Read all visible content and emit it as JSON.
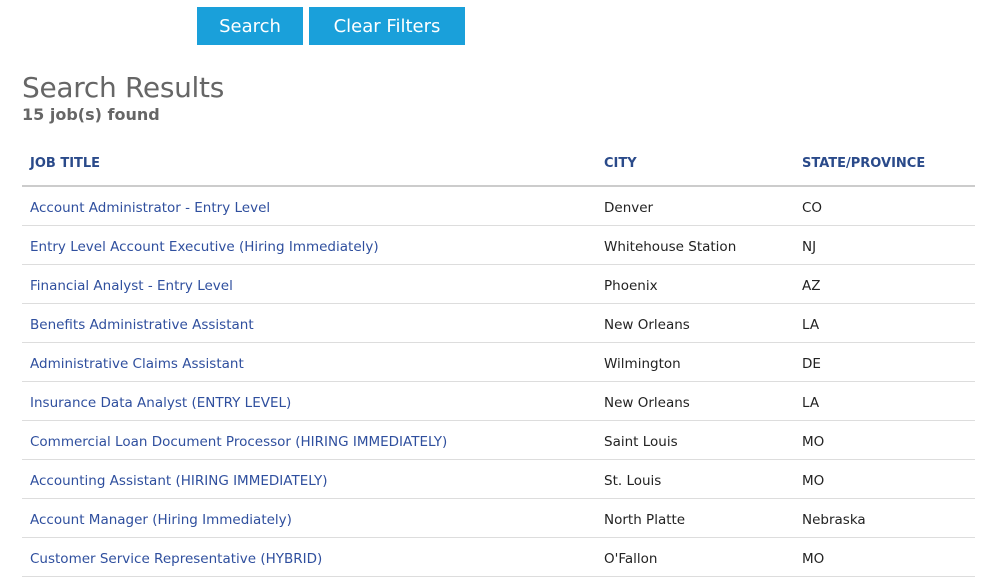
{
  "buttons": {
    "search_label": "Search",
    "clear_label": "Clear Filters"
  },
  "results": {
    "title": "Search Results",
    "count_text": "15 job(s) found"
  },
  "table": {
    "headers": {
      "job_title": "JOB TITLE",
      "city": "CITY",
      "state": "STATE/PROVINCE"
    },
    "rows": [
      {
        "title": "Account Administrator - Entry Level",
        "city": "Denver",
        "state": "CO"
      },
      {
        "title": "Entry Level Account Executive (Hiring Immediately)",
        "city": "Whitehouse Station",
        "state": "NJ"
      },
      {
        "title": "Financial Analyst - Entry Level",
        "city": "Phoenix",
        "state": "AZ"
      },
      {
        "title": "Benefits Administrative Assistant",
        "city": "New Orleans",
        "state": "LA"
      },
      {
        "title": "Administrative Claims Assistant",
        "city": "Wilmington",
        "state": "DE"
      },
      {
        "title": "Insurance Data Analyst (ENTRY LEVEL)",
        "city": "New Orleans",
        "state": "LA"
      },
      {
        "title": "Commercial Loan Document Processor (HIRING IMMEDIATELY)",
        "city": "Saint Louis",
        "state": "MO"
      },
      {
        "title": "Accounting Assistant (HIRING IMMEDIATELY)",
        "city": "St. Louis",
        "state": "MO"
      },
      {
        "title": "Account Manager (Hiring Immediately)",
        "city": "North Platte",
        "state": "Nebraska"
      },
      {
        "title": "Customer Service Representative (HYBRID)",
        "city": "O'Fallon",
        "state": "MO"
      }
    ]
  },
  "colors": {
    "button_bg": "#1aa0da",
    "link": "#2f4f9e",
    "header_text": "#2a4a8a"
  }
}
